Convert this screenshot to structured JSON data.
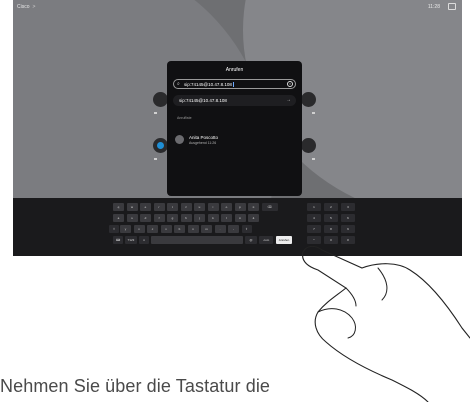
{
  "topbar": {
    "brand": "Cisco",
    "brand_chevron": ">",
    "time": "11:28",
    "camera_icon": "camera-icon"
  },
  "dialog": {
    "title": "Anrufen",
    "search_value": "sip:74145@10.47.8.108",
    "suggestion": "sip:74145@10.47.8.108",
    "recent_heading": "Anrufliste",
    "recent": [
      {
        "name": "Anita Poscotto",
        "detail": "Ausgehend 11:26"
      }
    ]
  },
  "keyboard": {
    "rows": [
      [
        "q",
        "w",
        "e",
        "r",
        "t",
        "z",
        "u",
        "i",
        "o",
        "p",
        "ü"
      ],
      [
        "a",
        "s",
        "d",
        "f",
        "g",
        "h",
        "j",
        "k",
        "l",
        "ö",
        "ä"
      ],
      [
        "y",
        "x",
        "c",
        "v",
        "b",
        "n",
        "m",
        ".",
        "-"
      ]
    ],
    "numpad": [
      [
        "1",
        "2",
        "3"
      ],
      [
        "4",
        "5",
        "6"
      ],
      [
        "7",
        "8",
        "9"
      ],
      [
        "*",
        "0",
        "#"
      ]
    ],
    "mode_key": "?123",
    "at_key": "@",
    "call_key": "Anrufen",
    "dotcom_key": ".com"
  },
  "caption": "Nehmen Sie über die Tastatur die"
}
